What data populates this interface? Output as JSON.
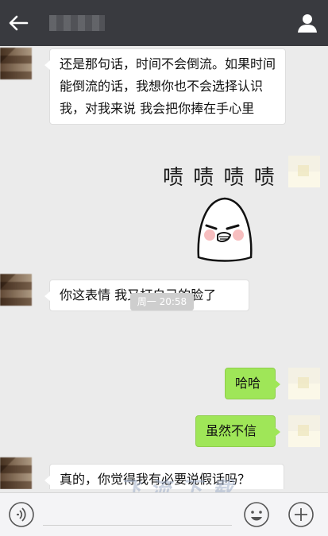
{
  "header": {
    "title": "",
    "back_icon": "arrow-left-icon",
    "profile_icon": "person-icon"
  },
  "messages": [
    {
      "from": "them",
      "text": "还是那句话，时间不会倒流。如果时间能倒流的话，我想你也不会选择认识我，对我来说 我会把你捧在手心里"
    },
    {
      "from": "me",
      "sticker_text": "啧 啧 啧 啧"
    },
    {
      "from": "them",
      "text": "你这表情 我又打自己的脸了"
    },
    {
      "from": "system",
      "text": "周一 20:58"
    },
    {
      "from": "me",
      "text": "哈哈"
    },
    {
      "from": "me",
      "text": "虽然不信"
    },
    {
      "from": "them",
      "text": "真的，你觉得我有必要说假话吗？"
    }
  ],
  "input": {
    "voice_icon": "voice-icon",
    "emoji_icon": "smiley-icon",
    "plus_icon": "plus-icon"
  },
  "colors": {
    "topbar": "#393a3f",
    "chat_bg": "#ebebeb",
    "bubble_green": "#9fe658",
    "bubble_white": "#ffffff"
  }
}
